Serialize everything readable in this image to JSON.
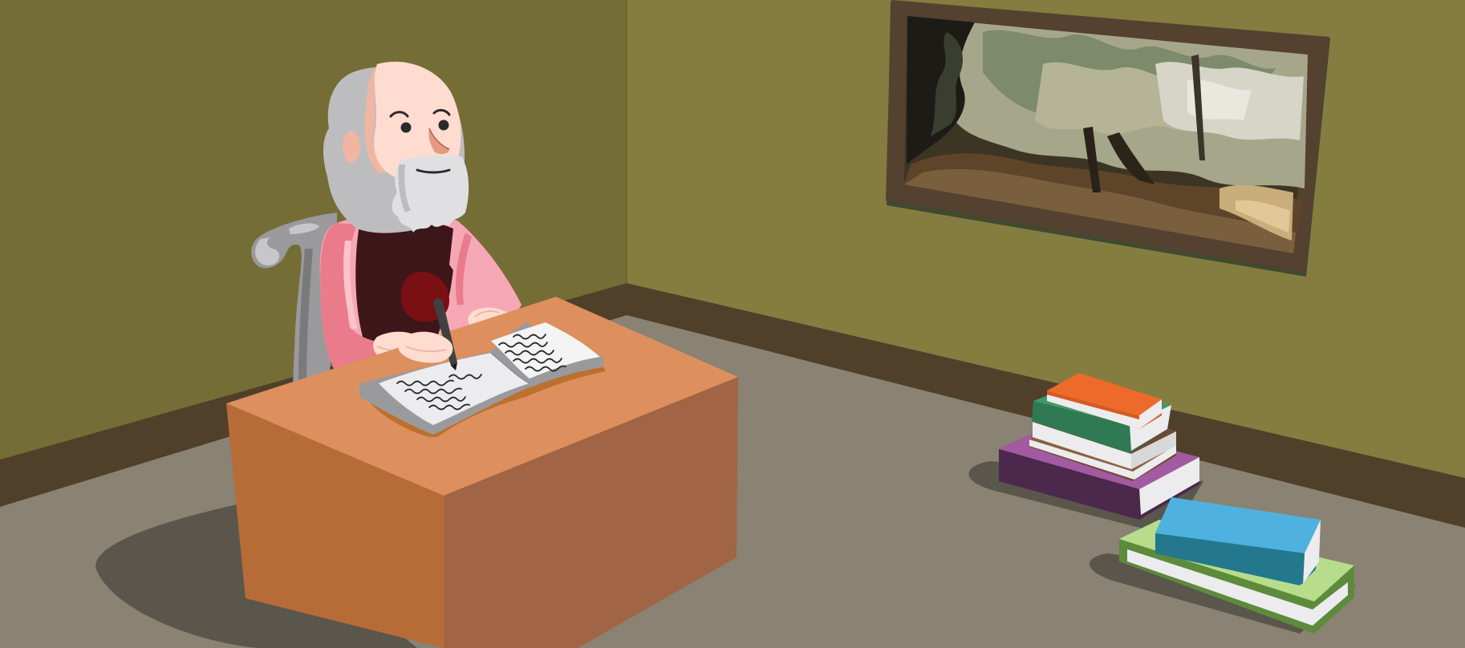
{
  "scene": {
    "kind": "illustration",
    "colors": {
      "wall_left": "#756d36",
      "wall_right": "#857c40",
      "baseboard": "#50402a",
      "floor": "#8a8273",
      "floor_shadow": "#5a564c",
      "desk_top": "#dd8f5d",
      "desk_front": "#b76c38",
      "desk_side": "#a16444",
      "skin": "#ffdccf",
      "hair": "#bdbdbf",
      "robe": "#f6a7b5",
      "robe_shade": "#e97b8a",
      "vest": "#3d161a",
      "chair": "#9a9a9c",
      "frame": "#54412f",
      "book_orange": "#ee6a2a",
      "book_green": "#3f9a6a",
      "book_brown": "#6e4a34",
      "book_purple": "#a25aa0",
      "book_blue": "#4eb1df",
      "book_lime": "#b7dc8c"
    },
    "elements": {
      "scholar": "bearded-scholar-writing",
      "chair": "scroll-back-chair",
      "desk": "wooden-desk",
      "open_book": "open-book-with-handwriting",
      "pen": "pen",
      "painting": "framed-landscape-painting",
      "book_stack_back": "stack-of-five-books",
      "book_stack_front": "stack-of-two-books"
    }
  }
}
